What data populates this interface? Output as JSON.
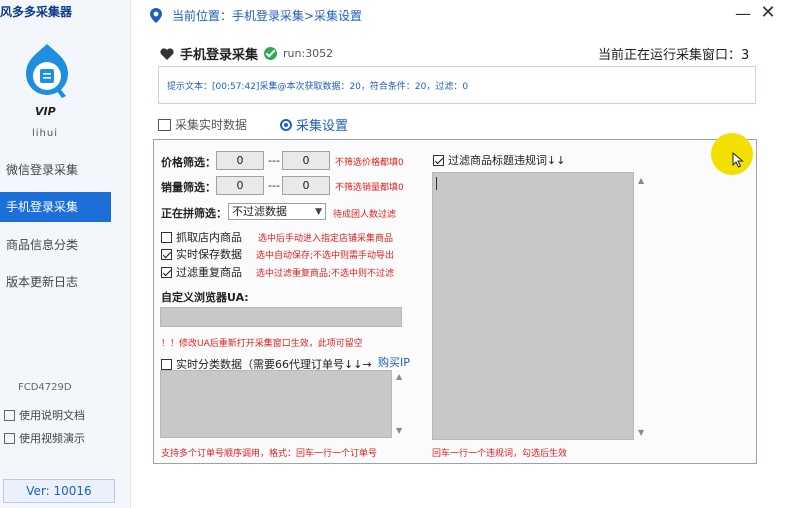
{
  "app": {
    "title": "风多多采集器",
    "vip_label": "VIP",
    "user": "lihui"
  },
  "sidebar": {
    "items": [
      {
        "label": "微信登录采集",
        "active": false
      },
      {
        "label": "手机登录采集",
        "active": true
      },
      {
        "label": "商品信息分类",
        "active": false
      },
      {
        "label": "版本更新日志",
        "active": false
      }
    ],
    "machine_code": "FCD4729D",
    "doc_link": "使用说明文档",
    "video_link": "使用视频演示",
    "version": "Ver:  10016"
  },
  "header": {
    "location": "当前位置：手机登录采集>采集设置",
    "minimize": "—",
    "close": "✕"
  },
  "section": {
    "title": "手机登录采集",
    "run_label": "run:3052",
    "window_count": "当前正在运行采集窗口：3"
  },
  "tip": {
    "text": "提示文本：[00:57:42]采集@本次获取数据：20，符合条件：20，过滤：0"
  },
  "tabs": {
    "realtime": "采集实时数据",
    "settings": "采集设置"
  },
  "settings": {
    "price": {
      "label": "价格筛选：",
      "min": "0",
      "sep": "---",
      "max": "0",
      "note": "不筛选价格都填0"
    },
    "sales": {
      "label": "销量筛选：",
      "min": "0",
      "sep": "---",
      "max": "0",
      "note": "不筛选销量都填0"
    },
    "group": {
      "label": "正在拼筛选：",
      "selected": "不过滤数据",
      "note": "待成团人数过滤"
    },
    "checks": [
      {
        "label": "抓取店内商品",
        "checked": false,
        "note": "选中后手动进入指定店铺采集商品"
      },
      {
        "label": "实时保存数据",
        "checked": true,
        "note": "选中自动保存;不选中则需手动导出"
      },
      {
        "label": "过滤重复商品",
        "checked": true,
        "note": "选中过滤重复商品;不选中则不过滤"
      }
    ],
    "ua": {
      "label": "自定义浏览器UA:",
      "value": "",
      "note": "！！修改UA后重新打开采集窗口生效，此项可留空"
    },
    "realtime_classify": {
      "label": "实时分类数据（需要66代理订单号↓↓→",
      "checked": false,
      "buy_ip": "购买IP"
    },
    "order_note": "支持多个订单号顺序调用，格式：回车一行一个订单号",
    "keyword_filter": {
      "label": "过滤商品标题违规词↓↓",
      "checked": true,
      "note": "回车一行一个违规词，勾选后生效"
    }
  },
  "colors": {
    "accent": "#1d6fd8",
    "warning": "#e02020",
    "link": "#1d5fc1",
    "cursor_highlight": "#f2e000"
  }
}
